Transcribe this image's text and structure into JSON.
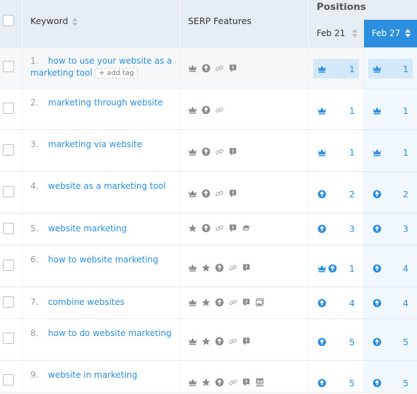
{
  "header": {
    "keyword_label": "Keyword",
    "serp_label": "SERP Features",
    "positions_label": "Positions",
    "dates": [
      {
        "label": "Feb 21",
        "active": false
      },
      {
        "label": "Feb 27",
        "active": true
      }
    ]
  },
  "colors": {
    "accent": "#2b8ede",
    "header_bg": "#e6edf3",
    "highlight_cell": "#d3e9fa",
    "active_column_bg": "#f0f7fd",
    "icon_gray": "#8a8a8a"
  },
  "add_tag_label": "+ add tag",
  "rows": [
    {
      "num": "1.",
      "keyword": "how to use your website as a marketing tool",
      "add_tag": true,
      "highlight": true,
      "serp": [
        "crown-icon",
        "plus-circle-icon",
        "link-icon",
        "review-icon"
      ],
      "feb21": {
        "icons": [
          "crown-icon"
        ],
        "value": "1"
      },
      "feb27": {
        "icons": [
          "crown-icon"
        ],
        "value": "1"
      }
    },
    {
      "num": "2.",
      "keyword": "marketing through website",
      "add_tag": false,
      "highlight": false,
      "serp": [
        "crown-icon",
        "plus-circle-icon",
        "link-icon"
      ],
      "feb21": {
        "icons": [
          "crown-icon"
        ],
        "value": "1"
      },
      "feb27": {
        "icons": [
          "crown-icon"
        ],
        "value": "1"
      }
    },
    {
      "num": "3.",
      "keyword": "marketing via website",
      "add_tag": false,
      "highlight": false,
      "serp": [
        "crown-icon",
        "plus-circle-icon",
        "link-icon",
        "review-icon"
      ],
      "feb21": {
        "icons": [
          "crown-icon"
        ],
        "value": "1"
      },
      "feb27": {
        "icons": [
          "crown-icon"
        ],
        "value": "1"
      }
    },
    {
      "num": "4.",
      "keyword": "website as a marketing tool",
      "add_tag": false,
      "highlight": false,
      "serp": [
        "crown-icon",
        "plus-circle-icon",
        "link-icon",
        "review-icon"
      ],
      "feb21": {
        "icons": [
          "plus-circle-icon"
        ],
        "value": "2"
      },
      "feb27": {
        "icons": [
          "plus-circle-icon"
        ],
        "value": "2"
      }
    },
    {
      "num": "5.",
      "keyword": "website marketing",
      "add_tag": false,
      "highlight": false,
      "serp": [
        "star-icon",
        "plus-circle-icon",
        "link-icon",
        "review-icon",
        "graduation-cap-icon"
      ],
      "feb21": {
        "icons": [
          "plus-circle-icon"
        ],
        "value": "3"
      },
      "feb27": {
        "icons": [
          "plus-circle-icon"
        ],
        "value": "3"
      }
    },
    {
      "num": "6.",
      "keyword": "how to website marketing",
      "add_tag": false,
      "highlight": false,
      "serp": [
        "crown-icon",
        "star-icon",
        "plus-circle-icon",
        "link-icon",
        "review-icon"
      ],
      "feb21": {
        "icons": [
          "crown-icon",
          "plus-circle-icon"
        ],
        "value": "1"
      },
      "feb27": {
        "icons": [
          "plus-circle-icon"
        ],
        "value": "4"
      }
    },
    {
      "num": "7.",
      "keyword": "combine websites",
      "add_tag": false,
      "highlight": false,
      "serp": [
        "crown-icon",
        "star-icon",
        "plus-circle-icon",
        "link-icon",
        "review-icon",
        "image-icon"
      ],
      "feb21": {
        "icons": [
          "plus-circle-icon"
        ],
        "value": "4"
      },
      "feb27": {
        "icons": [
          "plus-circle-icon"
        ],
        "value": "4"
      }
    },
    {
      "num": "8.",
      "keyword": "how to do website marketing",
      "add_tag": false,
      "highlight": false,
      "serp": [
        "crown-icon",
        "star-icon",
        "plus-circle-icon",
        "link-icon",
        "review-icon"
      ],
      "feb21": {
        "icons": [
          "plus-circle-icon"
        ],
        "value": "5"
      },
      "feb27": {
        "icons": [
          "plus-circle-icon"
        ],
        "value": "5"
      }
    },
    {
      "num": "9.",
      "keyword": "website in marketing",
      "add_tag": false,
      "highlight": false,
      "serp": [
        "crown-icon",
        "star-icon",
        "plus-circle-icon",
        "link-icon",
        "review-icon",
        "ad-icon"
      ],
      "feb21": {
        "icons": [
          "plus-circle-icon"
        ],
        "value": "5"
      },
      "feb27": {
        "icons": [
          "plus-circle-icon"
        ],
        "value": "5"
      }
    }
  ]
}
